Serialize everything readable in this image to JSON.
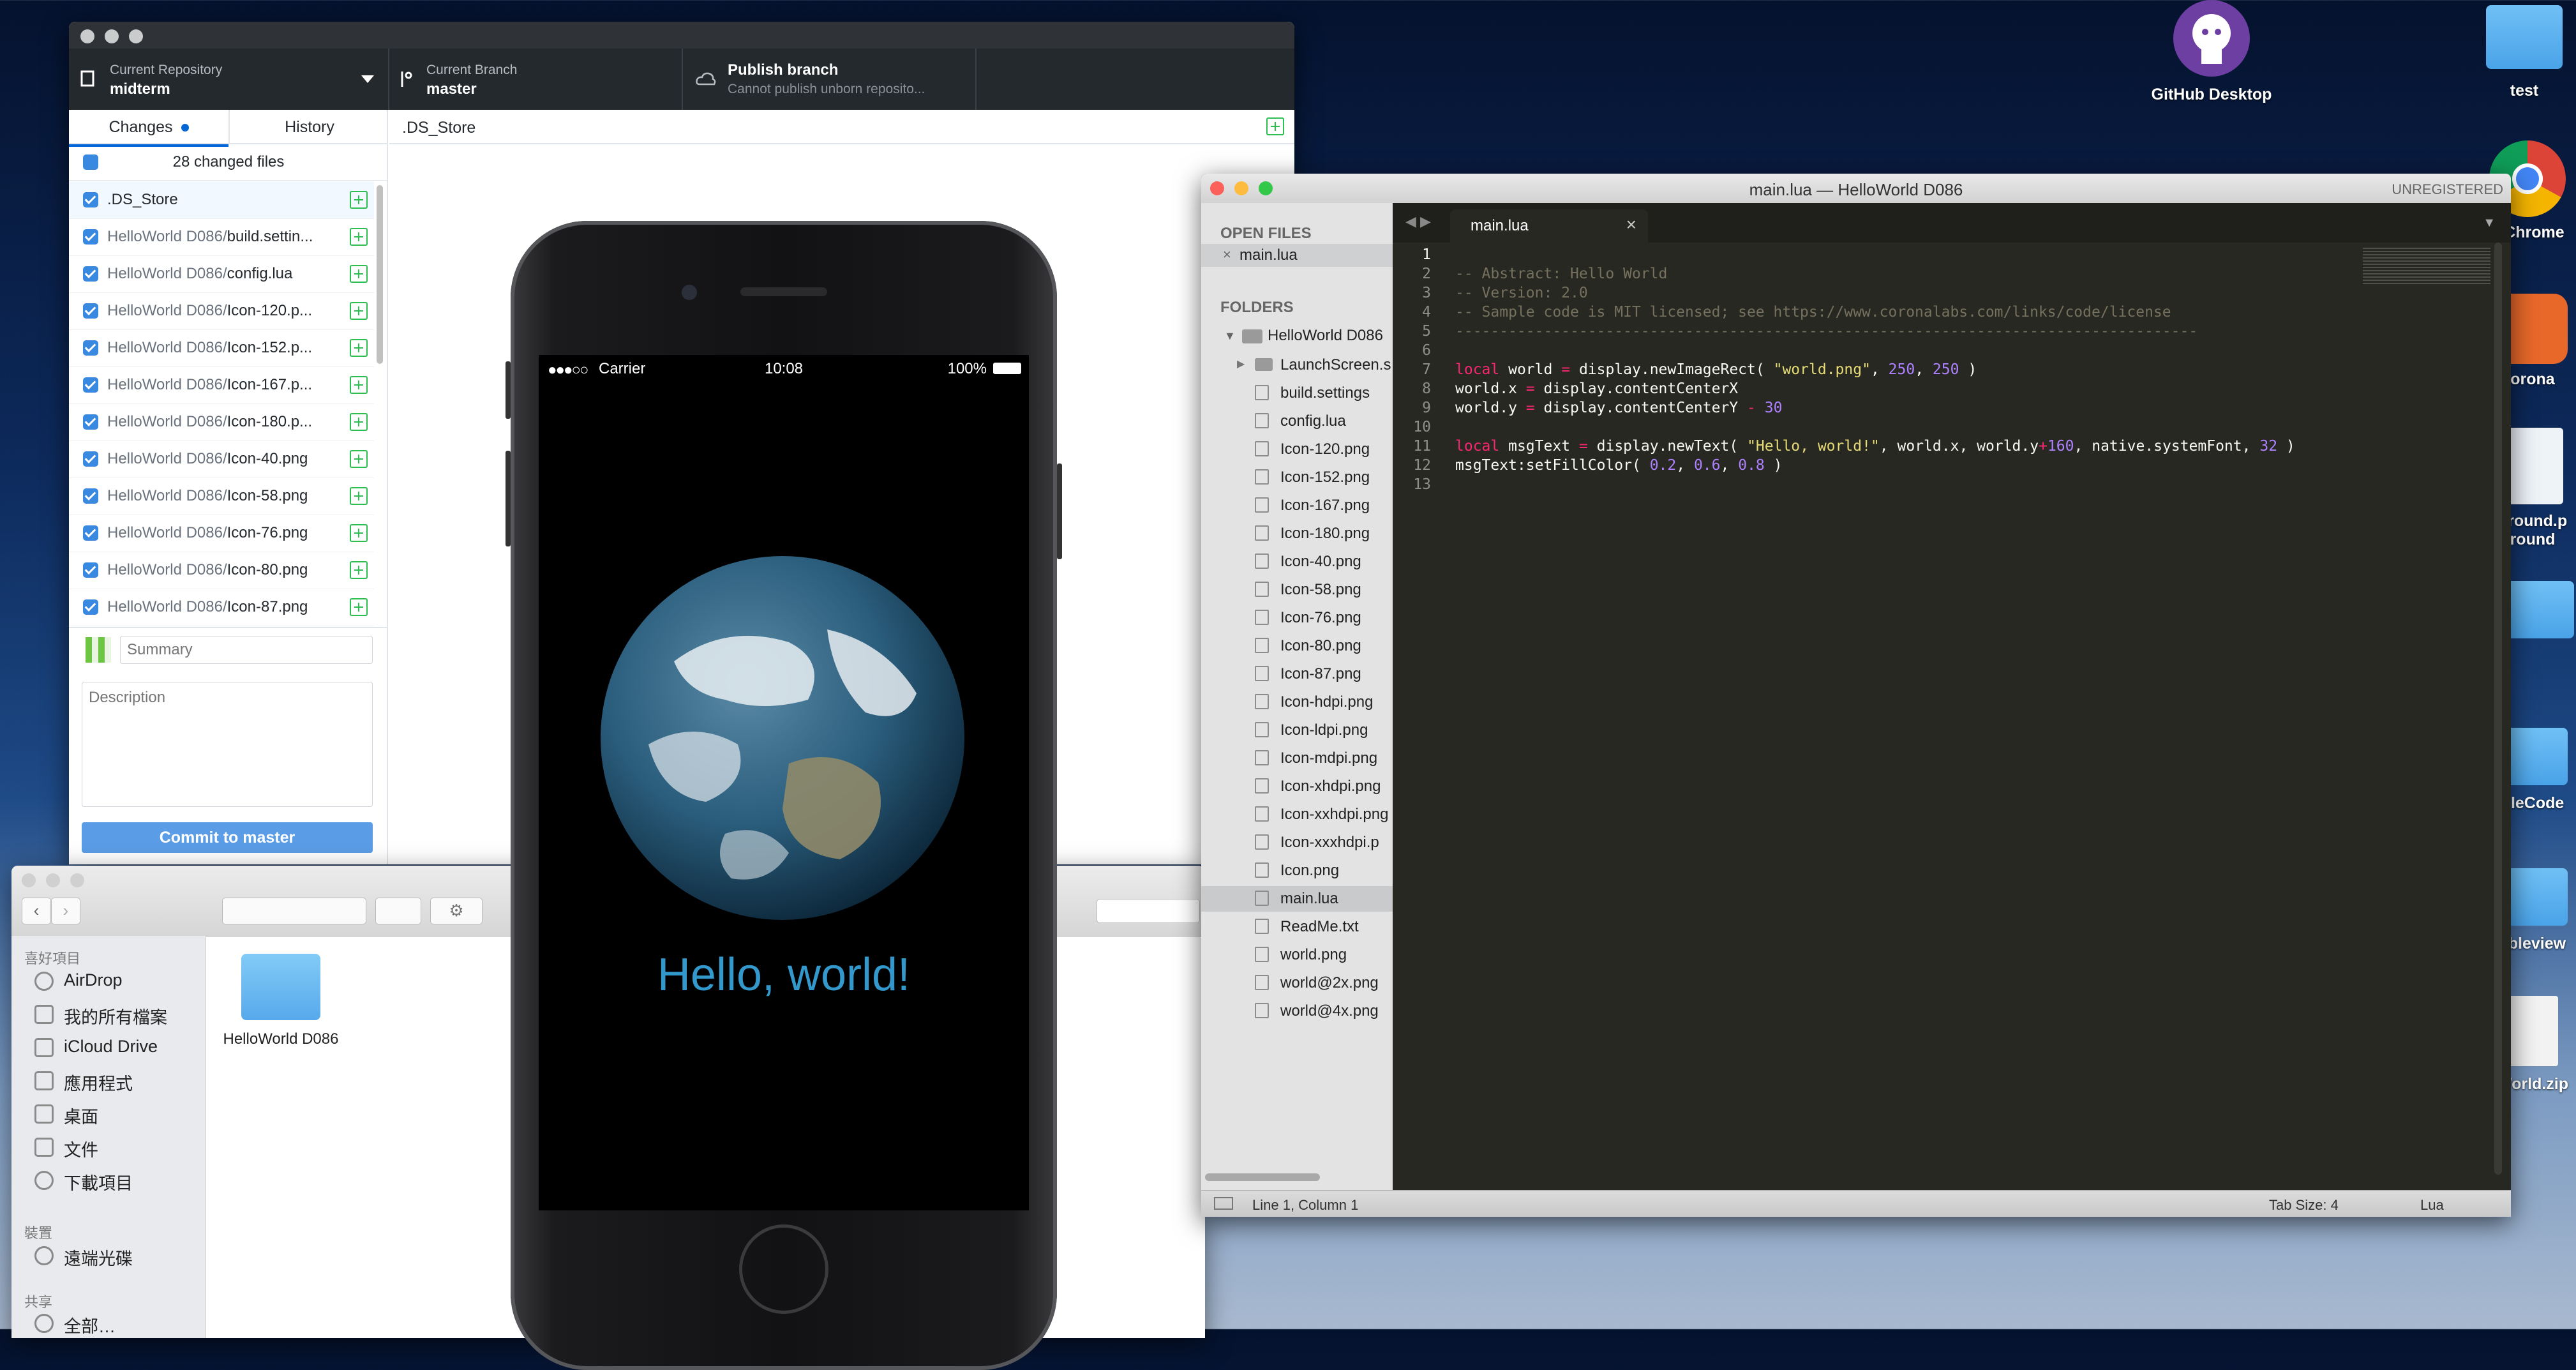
{
  "desktop": {
    "icons": [
      {
        "label": "GitHub Desktop"
      },
      {
        "label": "test"
      },
      {
        "label": "e Chrome"
      },
      {
        "label": "orona"
      },
      {
        "label": "ground.p"
      },
      {
        "label": "round"
      },
      {
        "label": "pleCode"
      },
      {
        "label": "ableview"
      },
      {
        "label": "World.zip"
      }
    ]
  },
  "github": {
    "current_repository_label": "Current Repository",
    "current_repository": "midterm",
    "current_branch_label": "Current Branch",
    "current_branch": "master",
    "publish_label": "Publish branch",
    "publish_sub": "Cannot publish unborn reposito...",
    "tab_changes": "Changes",
    "tab_history": "History",
    "changed_files": "28 changed files",
    "files": [
      {
        "dir": "",
        "name": ".DS_Store"
      },
      {
        "dir": "HelloWorld D086/",
        "name": "build.settin..."
      },
      {
        "dir": "HelloWorld D086/",
        "name": "config.lua"
      },
      {
        "dir": "HelloWorld D086/",
        "name": "Icon-120.p..."
      },
      {
        "dir": "HelloWorld D086/",
        "name": "Icon-152.p..."
      },
      {
        "dir": "HelloWorld D086/",
        "name": "Icon-167.p..."
      },
      {
        "dir": "HelloWorld D086/",
        "name": "Icon-180.p..."
      },
      {
        "dir": "HelloWorld D086/",
        "name": "Icon-40.png"
      },
      {
        "dir": "HelloWorld D086/",
        "name": "Icon-58.png"
      },
      {
        "dir": "HelloWorld D086/",
        "name": "Icon-76.png"
      },
      {
        "dir": "HelloWorld D086/",
        "name": "Icon-80.png"
      },
      {
        "dir": "HelloWorld D086/",
        "name": "Icon-87.png"
      }
    ],
    "summary_placeholder": "Summary",
    "description_placeholder": "Description",
    "commit_button": "Commit to master",
    "diff_filename": ".DS_Store"
  },
  "phone": {
    "carrier": "Carrier",
    "time": "10:08",
    "battery": "100%",
    "message": "Hello, world!"
  },
  "sublime": {
    "title": "main.lua — HelloWorld D086",
    "unregistered": "UNREGISTERED",
    "open_files_header": "OPEN FILES",
    "open_file": "main.lua",
    "folders_header": "FOLDERS",
    "root_folder": "HelloWorld D086",
    "tree": [
      "LaunchScreen.s",
      "build.settings",
      "config.lua",
      "Icon-120.png",
      "Icon-152.png",
      "Icon-167.png",
      "Icon-180.png",
      "Icon-40.png",
      "Icon-58.png",
      "Icon-76.png",
      "Icon-80.png",
      "Icon-87.png",
      "Icon-hdpi.png",
      "Icon-ldpi.png",
      "Icon-mdpi.png",
      "Icon-xhdpi.png",
      "Icon-xxhdpi.png",
      "Icon-xxxhdpi.p",
      "Icon.png",
      "main.lua",
      "ReadMe.txt",
      "world.png",
      "world@2x.png",
      "world@4x.png"
    ],
    "tab": "main.lua",
    "code": [
      "",
      "-- Abstract: Hello World",
      "-- Version: 2.0",
      "-- Sample code is MIT licensed; see https://www.coronalabs.com/links/code/license",
      "------------------------------------------------------------------------------------",
      "",
      "local world = display.newImageRect( \"world.png\", 250, 250 )",
      "world.x = display.contentCenterX",
      "world.y = display.contentCenterY - 30",
      "",
      "local msgText = display.newText( \"Hello, world!\", world.x, world.y+160, native.systemFont, 32 )",
      "msgText:setFillColor( 0.2, 0.6, 0.8 )",
      ""
    ],
    "status_position": "Line 1, Column 1",
    "status_tabsize": "Tab Size: 4",
    "status_syntax": "Lua"
  },
  "finder": {
    "favorites_header": "喜好項目",
    "favorites": [
      "AirDrop",
      "我的所有檔案",
      "iCloud Drive",
      "應用程式",
      "桌面",
      "文件",
      "下載項目"
    ],
    "devices_header": "裝置",
    "devices": [
      "遠端光碟"
    ],
    "shared_header": "共享",
    "shared": [
      "全部…"
    ],
    "folder": "HelloWorld D086"
  },
  "colors": {
    "github_dark": "#24292e",
    "commit_blue": "#5a9de6",
    "sublime_bg": "#272822",
    "hello_blue": "#3399cc"
  }
}
